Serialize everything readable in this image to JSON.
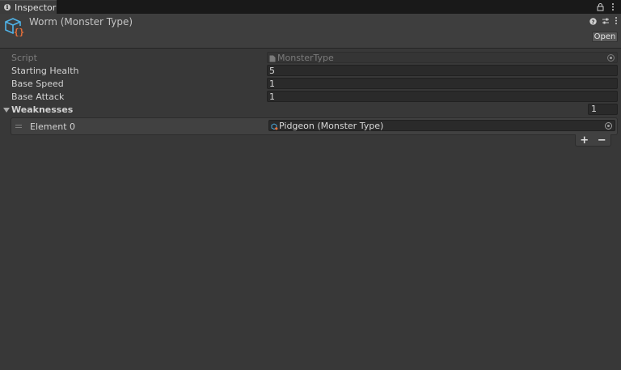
{
  "window": {
    "tab_label": "Inspector",
    "lock_icon": "lock-icon",
    "menu_icon": "kebab-menu-icon"
  },
  "header": {
    "title": "Worm (Monster Type)",
    "icons": [
      "help-icon",
      "settings-sliders-icon",
      "kebab-menu-icon"
    ],
    "open_label": "Open"
  },
  "properties": {
    "script": {
      "label": "Script",
      "value": "MonsterType"
    },
    "starting_health": {
      "label": "Starting Health",
      "value": "5"
    },
    "base_speed": {
      "label": "Base Speed",
      "value": "1"
    },
    "base_attack": {
      "label": "Base Attack",
      "value": "1"
    }
  },
  "weaknesses": {
    "label": "Weaknesses",
    "size": "1",
    "elements": [
      {
        "label": "Element 0",
        "value": "Pidgeon (Monster Type)"
      }
    ],
    "add_label": "+",
    "remove_label": "−"
  },
  "colors": {
    "background": "#383838",
    "tabbar": "#191919",
    "field": "#2a2a2a",
    "asset_icon_blue": "#4fb3e8",
    "asset_icon_orange": "#e8703a"
  }
}
